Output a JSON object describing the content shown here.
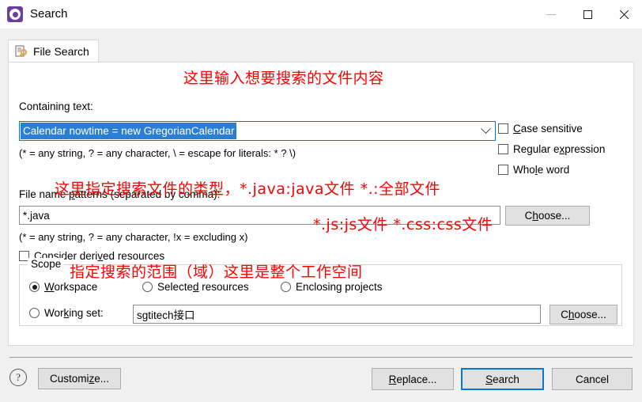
{
  "window": {
    "title": "Search",
    "icon": "search-gear-icon",
    "controls": {
      "minimize": "minimize-icon",
      "maximize": "maximize-icon",
      "close": "close-icon"
    }
  },
  "tab": {
    "label": "File Search",
    "icon": "file-search-icon"
  },
  "form": {
    "containing_text_label": "Containing text:",
    "containing_text_value": "Calendar nowtime = new GregorianCalendar",
    "containing_text_hint": "(* = any string, ? = any character, \\ = escape for literals: * ? \\)",
    "dropdown_icon": "chevron-down-icon",
    "options": [
      {
        "label": "Case sensitive",
        "checked": false
      },
      {
        "label": "Regular expression",
        "checked": false
      },
      {
        "label": "Whole word",
        "checked": false
      }
    ],
    "file_patterns_label": "File name patterns (separated by comma):",
    "file_patterns_value": "*.java",
    "file_patterns_hint": "(* = any string, ? = any character, !x = excluding x)",
    "patterns_choose_label": "Choose...",
    "consider_derived_label": "Consider derived resources",
    "consider_derived_checked": false
  },
  "scope": {
    "title": "Scope",
    "radios": [
      {
        "label": "Workspace",
        "selected": true
      },
      {
        "label": "Selected resources",
        "selected": false
      },
      {
        "label": "Enclosing projects",
        "selected": false
      }
    ],
    "working_set_label": "Working set:",
    "working_set_value": "sgtitech接口",
    "working_set_selected": false,
    "working_set_choose_label": "Choose..."
  },
  "footer": {
    "help_icon": "help-icon",
    "help_glyph": "?",
    "customize_label": "Customize...",
    "replace_label": "Replace...",
    "search_label": "Search",
    "cancel_label": "Cancel"
  },
  "annotations": [
    {
      "text": "这里输入想要搜索的文件内容"
    },
    {
      "text": "这里指定搜索文件的类型，*.java:java文件 *.:全部文件"
    },
    {
      "text": "*.js:js文件 *.css:css文件"
    },
    {
      "text": "指定搜索的范围（域）这里是整个工作空间"
    }
  ],
  "colors": {
    "annotation": "#ff0000",
    "accent": "#0078d7",
    "selection": "#2a7fd4",
    "dialog_bg": "#f0f0f0",
    "panel_bg": "#ffffff"
  }
}
